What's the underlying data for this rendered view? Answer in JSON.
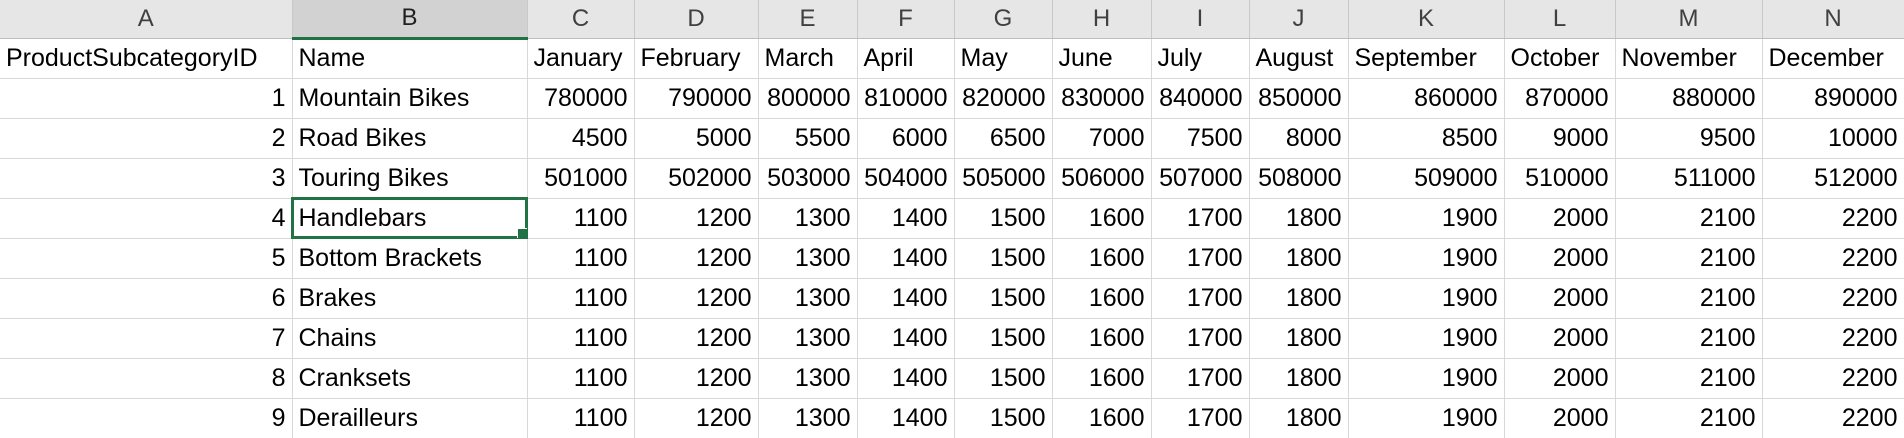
{
  "sheet": {
    "selected_column": "B",
    "active_cell": "B5",
    "accent_color": "#217346",
    "column_headers": [
      "A",
      "B",
      "C",
      "D",
      "E",
      "F",
      "G",
      "H",
      "I",
      "J",
      "K",
      "L",
      "M",
      "N"
    ],
    "rows": [
      [
        "ProductSubcategoryID",
        "Name",
        "January",
        "February",
        "March",
        "April",
        "May",
        "June",
        "July",
        "August",
        "September",
        "October",
        "November",
        "December"
      ],
      [
        "1",
        "Mountain Bikes",
        "780000",
        "790000",
        "800000",
        "810000",
        "820000",
        "830000",
        "840000",
        "850000",
        "860000",
        "870000",
        "880000",
        "890000"
      ],
      [
        "2",
        "Road Bikes",
        "4500",
        "5000",
        "5500",
        "6000",
        "6500",
        "7000",
        "7500",
        "8000",
        "8500",
        "9000",
        "9500",
        "10000"
      ],
      [
        "3",
        "Touring Bikes",
        "501000",
        "502000",
        "503000",
        "504000",
        "505000",
        "506000",
        "507000",
        "508000",
        "509000",
        "510000",
        "511000",
        "512000"
      ],
      [
        "4",
        "Handlebars",
        "1100",
        "1200",
        "1300",
        "1400",
        "1500",
        "1600",
        "1700",
        "1800",
        "1900",
        "2000",
        "2100",
        "2200"
      ],
      [
        "5",
        "Bottom Brackets",
        "1100",
        "1200",
        "1300",
        "1400",
        "1500",
        "1600",
        "1700",
        "1800",
        "1900",
        "2000",
        "2100",
        "2200"
      ],
      [
        "6",
        "Brakes",
        "1100",
        "1200",
        "1300",
        "1400",
        "1500",
        "1600",
        "1700",
        "1800",
        "1900",
        "2000",
        "2100",
        "2200"
      ],
      [
        "7",
        "Chains",
        "1100",
        "1200",
        "1300",
        "1400",
        "1500",
        "1600",
        "1700",
        "1800",
        "1900",
        "2000",
        "2100",
        "2200"
      ],
      [
        "8",
        "Cranksets",
        "1100",
        "1200",
        "1300",
        "1400",
        "1500",
        "1600",
        "1700",
        "1800",
        "1900",
        "2000",
        "2100",
        "2200"
      ],
      [
        "9",
        "Derailleurs",
        "1100",
        "1200",
        "1300",
        "1400",
        "1500",
        "1600",
        "1700",
        "1800",
        "1900",
        "2000",
        "2100",
        "2200"
      ]
    ]
  }
}
